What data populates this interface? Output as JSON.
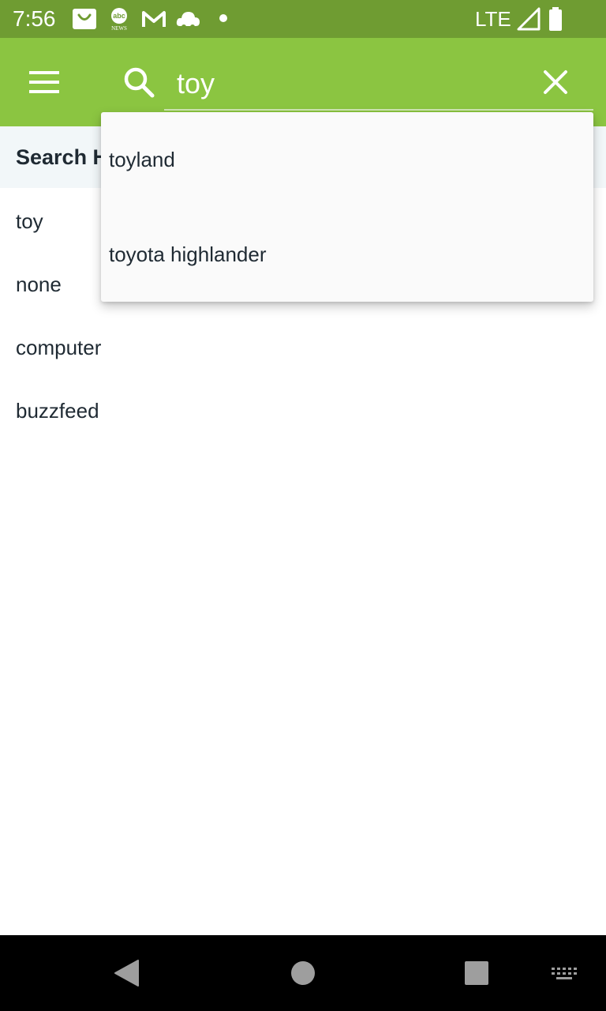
{
  "status_bar": {
    "time": "7:56",
    "network": "LTE",
    "notification_icons": [
      "shopping-bag-icon",
      "abc-news-icon",
      "gmail-icon",
      "cloud-icon"
    ]
  },
  "colors": {
    "status_bar": "#6f9c32",
    "app_bar": "#8bc541",
    "history_header_bg": "#f2f7f9",
    "text": "#1f2a33"
  },
  "search": {
    "query": "toy",
    "suggestions": [
      "toyland",
      "toyota highlander"
    ]
  },
  "history": {
    "header": "Search History",
    "items": [
      "toy",
      "none",
      "computer",
      "buzzfeed"
    ]
  },
  "nav_bar": {
    "buttons": [
      "back-icon",
      "home-icon",
      "recents-icon",
      "keyboard-icon"
    ]
  }
}
